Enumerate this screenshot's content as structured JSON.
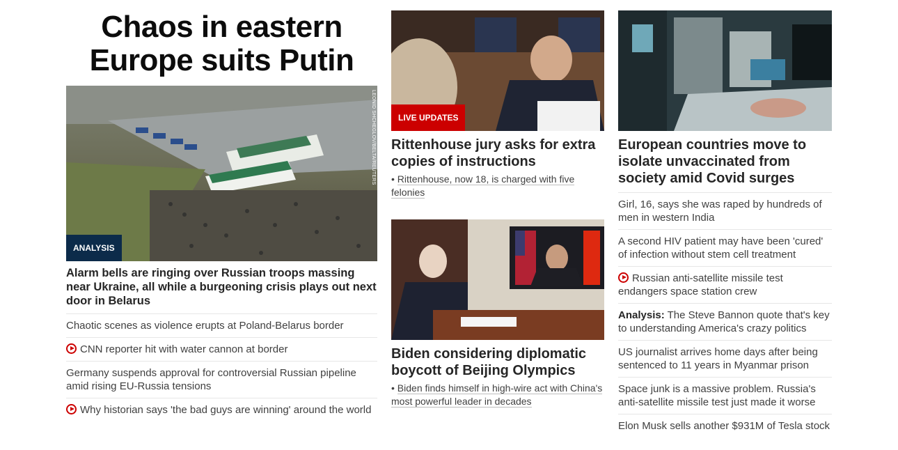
{
  "col1": {
    "headline": "Chaos in eastern Europe suits Putin",
    "image_credit": "LEONID SHCHEGLOV/BELTA/REUTERS",
    "tag": "ANALYSIS",
    "story": "Alarm bells are ringing over Russian troops massing near Ukraine, all while a burgeoning crisis plays out next door in Belarus",
    "links": [
      {
        "text": "Chaotic scenes as violence erupts at Poland-Belarus border",
        "video": false
      },
      {
        "text": "CNN reporter hit with water cannon at border",
        "video": true
      },
      {
        "text": "Germany suspends approval for controversial Russian pipeline amid rising EU-Russia tensions",
        "video": false
      },
      {
        "text": "Why historian says 'the bad guys are winning' around the world",
        "video": true
      }
    ]
  },
  "col2": {
    "story1": {
      "tag": "LIVE UPDATES",
      "title": "Rittenhouse jury asks for extra copies of instructions",
      "bullet": "Rittenhouse, now 18, is charged with five felonies"
    },
    "story2": {
      "title": "Biden considering diplomatic boycott of Beijing Olympics",
      "bullet": "Biden finds himself in high-wire act with China's most powerful leader in decades"
    }
  },
  "col3": {
    "title": "European countries move to isolate unvaccinated from society amid Covid surges",
    "links": [
      {
        "text": "Girl, 16, says she was raped by hundreds of men in western India",
        "video": false,
        "prefix": ""
      },
      {
        "text": "A second HIV patient may have been 'cured' of infection without stem cell treatment",
        "video": false,
        "prefix": ""
      },
      {
        "text": "Russian anti-satellite missile test endangers space station crew",
        "video": true,
        "prefix": ""
      },
      {
        "text": "The Steve Bannon quote that's key to understanding America's crazy politics",
        "video": false,
        "prefix": "Analysis:"
      },
      {
        "text": "US journalist arrives home days after being sentenced to 11 years in Myanmar prison",
        "video": false,
        "prefix": ""
      },
      {
        "text": "Space junk is a massive problem. Russia's anti-satellite missile test just made it worse",
        "video": false,
        "prefix": ""
      },
      {
        "text": "Elon Musk sells another $931M of Tesla stock",
        "video": false,
        "prefix": ""
      }
    ]
  },
  "colors": {
    "red": "#cc0000",
    "navy": "#0c2b4a"
  }
}
